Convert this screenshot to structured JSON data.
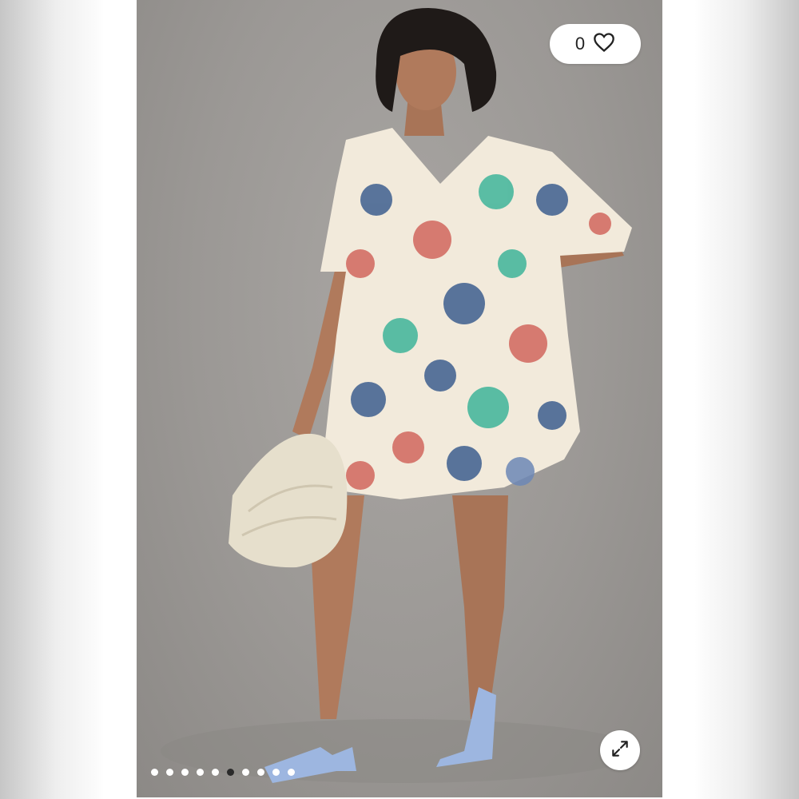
{
  "product_image": {
    "description_icon": "model-photo",
    "background_color": "#9b9895",
    "dress_base_color": "#f2eadb",
    "print_colors": [
      "#3e5f8f",
      "#d2675e",
      "#3fb59a",
      "#6d88b6"
    ]
  },
  "like_button": {
    "count": "0",
    "icon": "heart-icon"
  },
  "expand_button": {
    "icon": "expand-icon"
  },
  "carousel": {
    "total": 10,
    "active_index": 5
  }
}
